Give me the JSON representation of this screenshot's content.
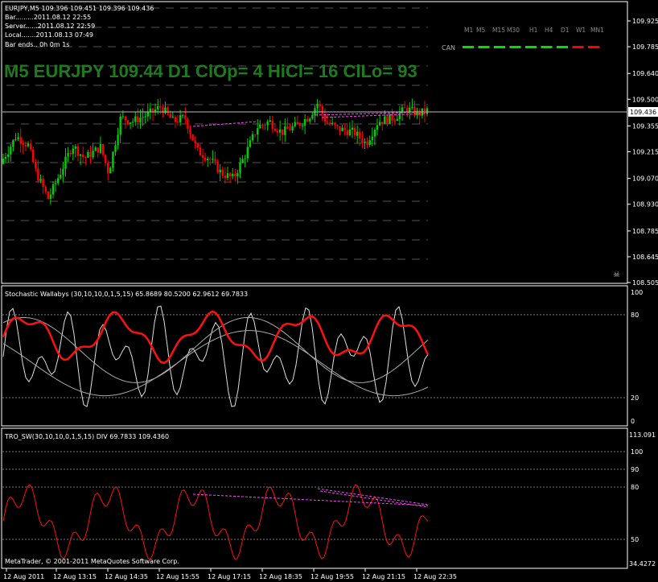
{
  "main": {
    "header": "EURJPY,M5  109.396  109.451  109.396  109.436",
    "info": [
      "Bar.........2011.08.12 22:55",
      "Server......2011.08.12 22:59",
      "Local.......2011.08.13 07:49",
      "Bar ends.. 0h 0m 1s"
    ],
    "big_label": "M5 EURJPY 109.44 D1 ClOp= 4 HiCl= 16 ClLo= 93",
    "timeframes": [
      "M1",
      "M5",
      "M15",
      "M30",
      "H1",
      "H4",
      "D1",
      "W1",
      "MN1"
    ],
    "can_label": "CAN",
    "can_colors": [
      "#00e000",
      "#00e000",
      "#00e000",
      "#00e000",
      "#00e000",
      "#00e000",
      "#00e000",
      "#ff0000",
      "#ff0000"
    ],
    "price_ticks": [
      "109.925",
      "109.785",
      "109.640",
      "109.500",
      "109.355",
      "109.215",
      "109.070",
      "108.930",
      "108.785",
      "108.645",
      "108.505"
    ],
    "current_price": "109.436",
    "colors": {
      "up": "#00d000",
      "down": "#ff0000",
      "divergence": "#ff44ff",
      "grid": "#555555",
      "ref": "#cccccc"
    }
  },
  "stoch": {
    "title": "Stochastic Wallabys (30,10,10,0,1,5,15) 65.8689 80.5200 62.9612 69.7833",
    "ticks": [
      "100",
      "80",
      "20",
      "0"
    ]
  },
  "tro": {
    "title": "TRO_SW(30,10,10,0,1,5,15) DIV 69.7833 109.4360",
    "ticks": [
      "113.091",
      "100",
      "90",
      "80",
      "50",
      "34.4272"
    ]
  },
  "footer": "MetaTrader, © 2001-2011 MetaQuotes Software Corp.",
  "time_labels": [
    "12 Aug 2011",
    "12 Aug 13:15",
    "12 Aug 14:35",
    "12 Aug 15:55",
    "12 Aug 17:15",
    "12 Aug 18:35",
    "12 Aug 19:55",
    "12 Aug 21:15",
    "12 Aug 22:35"
  ],
  "chart_data": {
    "type": "line",
    "title": "EURJPY,M5",
    "x": [
      "12 Aug 2011",
      "12 Aug 13:15",
      "12 Aug 14:35",
      "12 Aug 15:55",
      "12 Aug 17:15",
      "12 Aug 18:35",
      "12 Aug 19:55",
      "12 Aug 21:15",
      "12 Aug 22:35"
    ],
    "ylim": [
      108.505,
      109.925
    ],
    "series": [
      {
        "name": "EURJPY,M5",
        "values": [
          109.27,
          108.94,
          109.3,
          109.46,
          109.06,
          109.37,
          109.48,
          109.24,
          109.44
        ]
      }
    ],
    "indicators": [
      {
        "name": "Stochastic Wallabys (30,10,10,0,1,5,15)",
        "ylim": [
          0,
          100
        ],
        "levels": [
          80,
          20
        ],
        "last_values": [
          65.8689,
          80.52,
          62.9612,
          69.7833
        ]
      },
      {
        "name": "TRO_SW(30,10,10,0,1,5,15) DIV",
        "ylim": [
          34.4272,
          113.091
        ],
        "levels": [
          100,
          90,
          80,
          50
        ],
        "last_values": [
          69.7833,
          109.436
        ]
      }
    ]
  }
}
